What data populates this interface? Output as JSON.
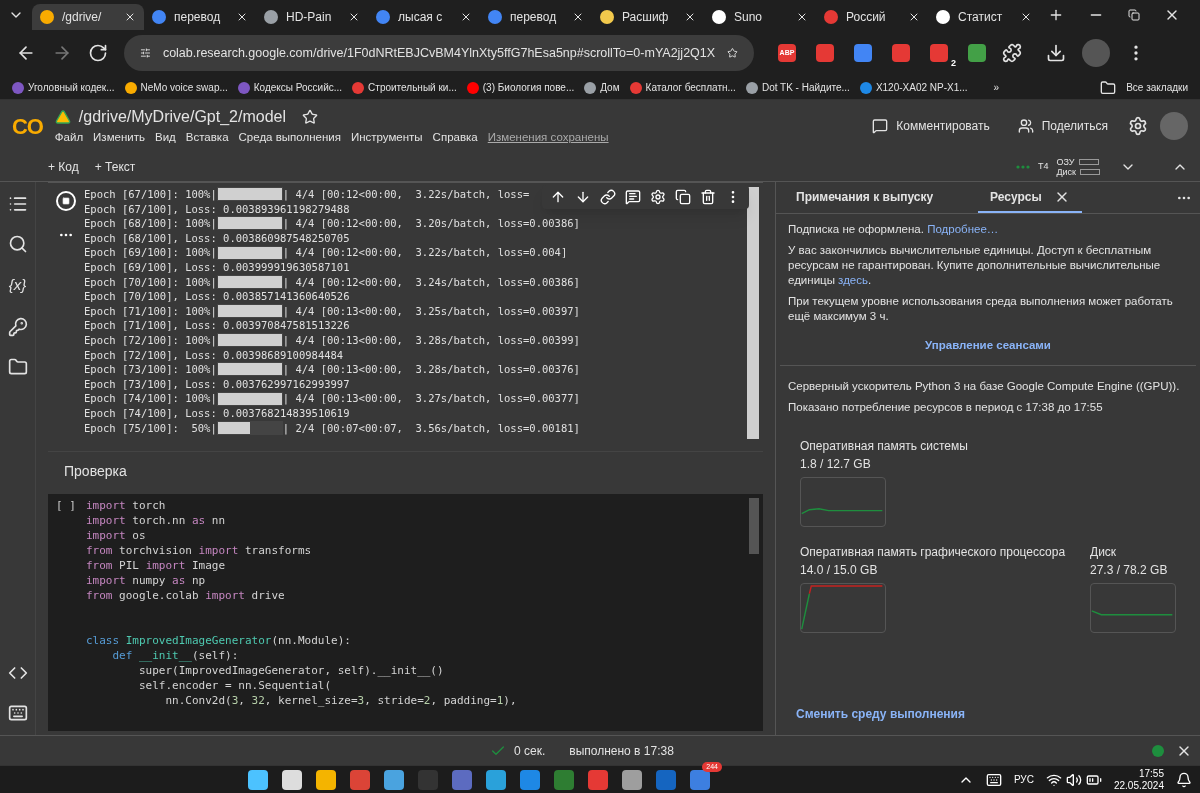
{
  "browser": {
    "tabs": [
      {
        "title": "/gdrive/",
        "selected": true,
        "color": "#f9ab00"
      },
      {
        "title": "перевод",
        "selected": false,
        "color": "#4285f4"
      },
      {
        "title": "HD-Pain",
        "selected": false,
        "color": "#9aa0a6"
      },
      {
        "title": "лысая с",
        "selected": false,
        "color": "#4285f4"
      },
      {
        "title": "перевод",
        "selected": false,
        "color": "#4285f4"
      },
      {
        "title": "Расшиф",
        "selected": false,
        "color": "#f2c94c"
      },
      {
        "title": "Suno",
        "selected": false,
        "color": "#ffffff"
      },
      {
        "title": "Россий",
        "selected": false,
        "color": "#e53935"
      },
      {
        "title": "Статист",
        "selected": false,
        "color": "#ffffff"
      }
    ],
    "url": "colab.research.google.com/drive/1F0dNRtEBJCvBM4YlnXty5ffG7hEsa5np#scrollTo=0-mYA2jj2Q1X",
    "extensions": [
      {
        "label": "ABP",
        "color": "#e53935"
      },
      {
        "color": "#e53935"
      },
      {
        "color": "#4285f4"
      },
      {
        "color": "#e53935"
      },
      {
        "label": "2",
        "color": "#e53935"
      },
      {
        "color": "#43a047"
      }
    ],
    "bookmarks": [
      {
        "title": "Уголовный кодек...",
        "color": "#7e57c2"
      },
      {
        "title": "NeMo voice swap...",
        "color": "#f9ab00"
      },
      {
        "title": "Кодексы Российс...",
        "color": "#7e57c2"
      },
      {
        "title": "Строительный ки...",
        "color": "#e53935"
      },
      {
        "title": "(3) Биология пове...",
        "color": "#ff0000"
      },
      {
        "title": "Дом",
        "color": "#9aa0a6"
      },
      {
        "title": "Каталог бесплатн...",
        "color": "#e53935"
      },
      {
        "title": "Dot TK - Найдите...",
        "color": "#9aa0a6"
      },
      {
        "title": "X120-XA02 NP-X1...",
        "color": "#1e88e5"
      }
    ],
    "more_bookmarks": "»",
    "all_bookmarks": "Все закладки"
  },
  "colab": {
    "logo": "CO",
    "path": "/gdrive/MyDrive/Gpt_2/model",
    "menu": [
      "Файл",
      "Изменить",
      "Вид",
      "Вставка",
      "Среда выполнения",
      "Инструменты",
      "Справка"
    ],
    "saved_status": "Изменения сохранены",
    "comment_button": "Комментировать",
    "share_button": "Поделиться",
    "add_code": "+ Код",
    "add_text": "+ Текст",
    "runtime": {
      "accelerator": "T4",
      "ram_label": "ОЗУ",
      "disk_label": "Диск",
      "connected": true
    },
    "rail_variables_icon": "{x}",
    "output_cell": {
      "lines": [
        {
          "kind": "progress",
          "prefix": "Epoch [67/100]: 100%|",
          "level": 1,
          "suffix": "| 4/4 [00:12<00:00,  3.22s/batch, loss="
        },
        {
          "kind": "text",
          "text": "Epoch [67/100], Loss: 0.003893961198279488"
        },
        {
          "kind": "progress",
          "prefix": "Epoch [68/100]: 100%|",
          "level": 1,
          "suffix": "| 4/4 [00:12<00:00,  3.20s/batch, loss=0.00386]"
        },
        {
          "kind": "text",
          "text": "Epoch [68/100], Loss: 0.003860987548250705"
        },
        {
          "kind": "progress",
          "prefix": "Epoch [69/100]: 100%|",
          "level": 1,
          "suffix": "| 4/4 [00:12<00:00,  3.22s/batch, loss=0.004]"
        },
        {
          "kind": "text",
          "text": "Epoch [69/100], Loss: 0.003999919630587101"
        },
        {
          "kind": "progress",
          "prefix": "Epoch [70/100]: 100%|",
          "level": 1,
          "suffix": "| 4/4 [00:12<00:00,  3.24s/batch, loss=0.00386]"
        },
        {
          "kind": "text",
          "text": "Epoch [70/100], Loss: 0.003857141360640526"
        },
        {
          "kind": "progress",
          "prefix": "Epoch [71/100]: 100%|",
          "level": 1,
          "suffix": "| 4/4 [00:13<00:00,  3.25s/batch, loss=0.00397]"
        },
        {
          "kind": "text",
          "text": "Epoch [71/100], Loss: 0.003970847581513226"
        },
        {
          "kind": "progress",
          "prefix": "Epoch [72/100]: 100%|",
          "level": 1,
          "suffix": "| 4/4 [00:13<00:00,  3.28s/batch, loss=0.00399]"
        },
        {
          "kind": "text",
          "text": "Epoch [72/100], Loss: 0.00398689100984484"
        },
        {
          "kind": "progress",
          "prefix": "Epoch [73/100]: 100%|",
          "level": 1,
          "suffix": "| 4/4 [00:13<00:00,  3.28s/batch, loss=0.00376]"
        },
        {
          "kind": "text",
          "text": "Epoch [73/100], Loss: 0.003762997162993997"
        },
        {
          "kind": "progress",
          "prefix": "Epoch [74/100]: 100%|",
          "level": 1,
          "suffix": "| 4/4 [00:13<00:00,  3.27s/batch, loss=0.00377]"
        },
        {
          "kind": "text",
          "text": "Epoch [74/100], Loss: 0.003768214839510619"
        },
        {
          "kind": "progress",
          "prefix": "Epoch [75/100]:  50%|",
          "level": 0.5,
          "suffix": "| 2/4 [00:07<00:07,  3.56s/batch, loss=0.00181]"
        }
      ]
    },
    "text_cell": "Проверка",
    "code_cell": {
      "prompt": "[ ]",
      "lines": [
        {
          "tokens": [
            {
              "t": "import",
              "kind": "kw"
            },
            {
              "t": " torch",
              "kind": "id"
            }
          ]
        },
        {
          "tokens": [
            {
              "t": "import",
              "kind": "kw"
            },
            {
              "t": " torch.nn ",
              "kind": "id"
            },
            {
              "t": "as",
              "kind": "kw"
            },
            {
              "t": " nn",
              "kind": "id"
            }
          ]
        },
        {
          "tokens": [
            {
              "t": "import",
              "kind": "kw"
            },
            {
              "t": " os",
              "kind": "id"
            }
          ]
        },
        {
          "tokens": [
            {
              "t": "from",
              "kind": "kw"
            },
            {
              "t": " torchvision ",
              "kind": "id"
            },
            {
              "t": "import",
              "kind": "kw"
            },
            {
              "t": " transforms",
              "kind": "id"
            }
          ]
        },
        {
          "tokens": [
            {
              "t": "from",
              "kind": "kw"
            },
            {
              "t": " PIL ",
              "kind": "id"
            },
            {
              "t": "import",
              "kind": "kw"
            },
            {
              "t": " Image",
              "kind": "id"
            }
          ]
        },
        {
          "tokens": [
            {
              "t": "import",
              "kind": "kw"
            },
            {
              "t": " numpy ",
              "kind": "id"
            },
            {
              "t": "as",
              "kind": "kw"
            },
            {
              "t": " np",
              "kind": "id"
            }
          ]
        },
        {
          "tokens": [
            {
              "t": "from",
              "kind": "kw"
            },
            {
              "t": " google.colab ",
              "kind": "id"
            },
            {
              "t": "import",
              "kind": "kw"
            },
            {
              "t": " drive",
              "kind": "id"
            }
          ]
        },
        {
          "blank_lines_before": true,
          "tokens": [
            {
              "t": "class",
              "kind": "def"
            },
            {
              "t": " ImprovedImageGenerator",
              "kind": "name"
            },
            {
              "t": "(nn.Module):",
              "kind": "id"
            }
          ]
        },
        {
          "tokens": [
            {
              "t": "    def",
              "kind": "def"
            },
            {
              "t": " __init__",
              "kind": "name"
            },
            {
              "t": "(self):",
              "kind": "id"
            }
          ]
        },
        {
          "tokens": [
            {
              "t": "        super(ImprovedImageGenerator, self).__init__()",
              "kind": "id"
            }
          ]
        },
        {
          "tokens": [
            {
              "t": "        self.encoder = nn.Sequential(",
              "kind": "id"
            }
          ]
        },
        {
          "tokens": [
            {
              "t": "            nn.Conv2d(",
              "kind": "id"
            },
            {
              "t": "3",
              "kind": "num"
            },
            {
              "t": ", ",
              "kind": "id"
            },
            {
              "t": "32",
              "kind": "num"
            },
            {
              "t": ", kernel_size=",
              "kind": "id"
            },
            {
              "t": "3",
              "kind": "num"
            },
            {
              "t": ", stride=",
              "kind": "id"
            },
            {
              "t": "2",
              "kind": "num"
            },
            {
              "t": ", padding=",
              "kind": "id"
            },
            {
              "t": "1",
              "kind": "num"
            },
            {
              "t": "),",
              "kind": "id"
            }
          ]
        }
      ]
    },
    "panel": {
      "tabs": [
        {
          "label": "Примечания к выпуску",
          "selected": false
        },
        {
          "label": "Ресурсы",
          "selected": true,
          "closable": true
        }
      ],
      "paragraphs": [
        {
          "text": "Подписка не оформлена. ",
          "link": "Подробнее…"
        },
        {
          "text": "У вас закончились вычислительные единицы. Доступ к бесплатным ресурсам не гарантирован. Купите дополнительные вычислительные единицы ",
          "link": "здесь",
          "after": "."
        },
        {
          "text": "При текущем уровне использования среда выполнения может работать ещё максимум 3 ч."
        }
      ],
      "manage_sessions": "Управление сеансами",
      "backend": "Серверный ускоритель Python 3 на базе Google Compute Engine ((GPU)).",
      "period": "Показано потребление ресурсов в период с 17:38 до 17:55",
      "meters": [
        {
          "kind": "ram",
          "label": "Оперативная память системы",
          "reading": "1.8 / 12.7 GB"
        },
        {
          "kind": "gpu",
          "label": "Оперативная память графического процессора",
          "reading": "14.0 / 15.0 GB"
        },
        {
          "kind": "disk",
          "label": "Диск",
          "reading": "27.3 / 78.2 GB"
        }
      ],
      "change_runtime": "Сменить среду выполнения"
    },
    "status": {
      "elapsed": "0 сек.",
      "finished": "выполнено в 17:38",
      "connected": true
    }
  },
  "taskbar": {
    "telegram_badge": "244",
    "language": "РУС",
    "time": "17:55",
    "date": "22.05.2024"
  }
}
